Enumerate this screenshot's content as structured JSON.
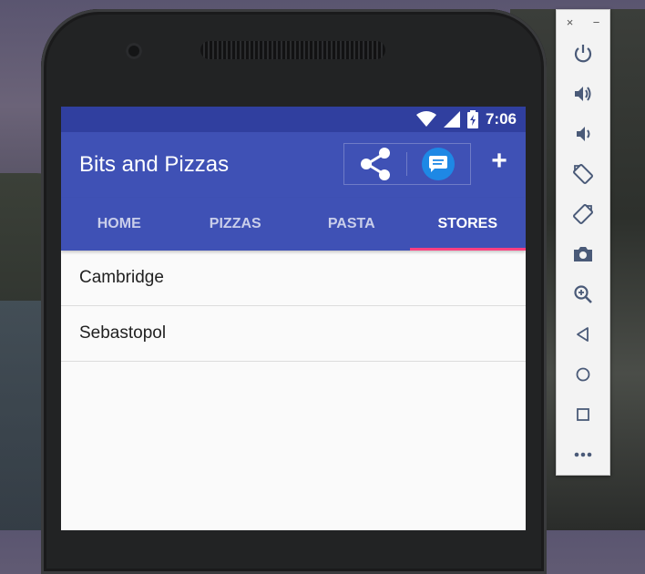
{
  "status_bar": {
    "time": "7:06"
  },
  "toolbar": {
    "title": "Bits and Pizzas",
    "share_icon": "share-icon",
    "message_icon": "message-icon",
    "add_label": "+"
  },
  "tabs": [
    {
      "label": "HOME",
      "active": false
    },
    {
      "label": "PIZZAS",
      "active": false
    },
    {
      "label": "PASTA",
      "active": false
    },
    {
      "label": "STORES",
      "active": true
    }
  ],
  "stores": [
    {
      "name": "Cambridge"
    },
    {
      "name": "Sebastopol"
    }
  ],
  "emulator": {
    "close_label": "×",
    "minimize_label": "−",
    "buttons": [
      "power-icon",
      "volume-up-icon",
      "volume-down-icon",
      "rotate-left-icon",
      "rotate-right-icon",
      "camera-icon",
      "zoom-icon",
      "back-icon",
      "home-icon",
      "overview-icon",
      "more-icon"
    ]
  },
  "colors": {
    "primary": "#3f51b5",
    "primary_dark": "#303f9f",
    "accent": "#ff4081",
    "message_button": "#1e88e5"
  }
}
